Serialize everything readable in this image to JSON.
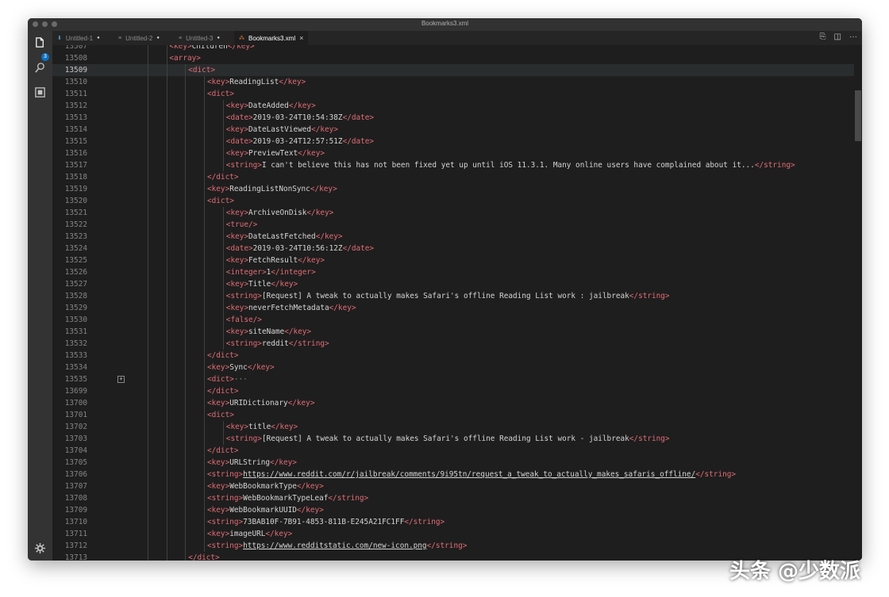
{
  "window": {
    "title": "Bookmarks3.xml"
  },
  "activity": {
    "badge": "3",
    "icons": [
      "files-icon",
      "search-icon",
      "extensions-icon",
      "gear-icon"
    ]
  },
  "tabs": [
    {
      "label": "Untitled-1",
      "icon": "pin-icon",
      "modified": "●"
    },
    {
      "label": "Untitled-2",
      "icon": "file-icon",
      "modified": "●"
    },
    {
      "label": "Untitled-3",
      "icon": "file-icon",
      "modified": "●"
    },
    {
      "label": "Bookmarks3.xml",
      "icon": "xml-icon",
      "close": "×",
      "active": true
    }
  ],
  "editor_actions": [
    "compare-icon",
    "split-icon",
    "more-icon"
  ],
  "editor": {
    "current_line": "13509",
    "lines": [
      {
        "n": "13507",
        "indent": 3,
        "parts": [
          {
            "t": "tag",
            "v": "<key>"
          },
          {
            "t": "txt",
            "v": "Children"
          },
          {
            "t": "tag",
            "v": "</key>"
          }
        ]
      },
      {
        "n": "13508",
        "indent": 3,
        "parts": [
          {
            "t": "tag",
            "v": "<array>"
          }
        ]
      },
      {
        "n": "13509",
        "indent": 4,
        "parts": [
          {
            "t": "tag",
            "v": "<dict>"
          }
        ]
      },
      {
        "n": "13510",
        "indent": 5,
        "parts": [
          {
            "t": "tag",
            "v": "<key>"
          },
          {
            "t": "txt",
            "v": "ReadingList"
          },
          {
            "t": "tag",
            "v": "</key>"
          }
        ]
      },
      {
        "n": "13511",
        "indent": 5,
        "parts": [
          {
            "t": "tag",
            "v": "<dict>"
          }
        ]
      },
      {
        "n": "13512",
        "indent": 6,
        "parts": [
          {
            "t": "tag",
            "v": "<key>"
          },
          {
            "t": "txt",
            "v": "DateAdded"
          },
          {
            "t": "tag",
            "v": "</key>"
          }
        ]
      },
      {
        "n": "13513",
        "indent": 6,
        "parts": [
          {
            "t": "tag",
            "v": "<date>"
          },
          {
            "t": "txt",
            "v": "2019-03-24T10:54:38Z"
          },
          {
            "t": "tag",
            "v": "</date>"
          }
        ]
      },
      {
        "n": "13514",
        "indent": 6,
        "parts": [
          {
            "t": "tag",
            "v": "<key>"
          },
          {
            "t": "txt",
            "v": "DateLastViewed"
          },
          {
            "t": "tag",
            "v": "</key>"
          }
        ]
      },
      {
        "n": "13515",
        "indent": 6,
        "parts": [
          {
            "t": "tag",
            "v": "<date>"
          },
          {
            "t": "txt",
            "v": "2019-03-24T12:57:51Z"
          },
          {
            "t": "tag",
            "v": "</date>"
          }
        ]
      },
      {
        "n": "13516",
        "indent": 6,
        "parts": [
          {
            "t": "tag",
            "v": "<key>"
          },
          {
            "t": "txt",
            "v": "PreviewText"
          },
          {
            "t": "tag",
            "v": "</key>"
          }
        ]
      },
      {
        "n": "13517",
        "indent": 6,
        "parts": [
          {
            "t": "tag",
            "v": "<string>"
          },
          {
            "t": "txt",
            "v": "I can't believe this has not been fixed yet up until iOS 11.3.1. Many online users have complained about it..."
          },
          {
            "t": "tag",
            "v": "</string>"
          }
        ]
      },
      {
        "n": "13518",
        "indent": 5,
        "parts": [
          {
            "t": "tag",
            "v": "</dict>"
          }
        ]
      },
      {
        "n": "13519",
        "indent": 5,
        "parts": [
          {
            "t": "tag",
            "v": "<key>"
          },
          {
            "t": "txt",
            "v": "ReadingListNonSync"
          },
          {
            "t": "tag",
            "v": "</key>"
          }
        ]
      },
      {
        "n": "13520",
        "indent": 5,
        "parts": [
          {
            "t": "tag",
            "v": "<dict>"
          }
        ]
      },
      {
        "n": "13521",
        "indent": 6,
        "parts": [
          {
            "t": "tag",
            "v": "<key>"
          },
          {
            "t": "txt",
            "v": "ArchiveOnDisk"
          },
          {
            "t": "tag",
            "v": "</key>"
          }
        ]
      },
      {
        "n": "13522",
        "indent": 6,
        "parts": [
          {
            "t": "tag",
            "v": "<true/>"
          }
        ]
      },
      {
        "n": "13523",
        "indent": 6,
        "parts": [
          {
            "t": "tag",
            "v": "<key>"
          },
          {
            "t": "txt",
            "v": "DateLastFetched"
          },
          {
            "t": "tag",
            "v": "</key>"
          }
        ]
      },
      {
        "n": "13524",
        "indent": 6,
        "parts": [
          {
            "t": "tag",
            "v": "<date>"
          },
          {
            "t": "txt",
            "v": "2019-03-24T10:56:12Z"
          },
          {
            "t": "tag",
            "v": "</date>"
          }
        ]
      },
      {
        "n": "13525",
        "indent": 6,
        "parts": [
          {
            "t": "tag",
            "v": "<key>"
          },
          {
            "t": "txt",
            "v": "FetchResult"
          },
          {
            "t": "tag",
            "v": "</key>"
          }
        ]
      },
      {
        "n": "13526",
        "indent": 6,
        "parts": [
          {
            "t": "tag",
            "v": "<integer>"
          },
          {
            "t": "txt",
            "v": "1"
          },
          {
            "t": "tag",
            "v": "</integer>"
          }
        ]
      },
      {
        "n": "13527",
        "indent": 6,
        "parts": [
          {
            "t": "tag",
            "v": "<key>"
          },
          {
            "t": "txt",
            "v": "Title"
          },
          {
            "t": "tag",
            "v": "</key>"
          }
        ]
      },
      {
        "n": "13528",
        "indent": 6,
        "parts": [
          {
            "t": "tag",
            "v": "<string>"
          },
          {
            "t": "txt",
            "v": "[Request] A tweak to actually makes Safari's offline Reading List work : jailbreak"
          },
          {
            "t": "tag",
            "v": "</string>"
          }
        ]
      },
      {
        "n": "13529",
        "indent": 6,
        "parts": [
          {
            "t": "tag",
            "v": "<key>"
          },
          {
            "t": "txt",
            "v": "neverFetchMetadata"
          },
          {
            "t": "tag",
            "v": "</key>"
          }
        ]
      },
      {
        "n": "13530",
        "indent": 6,
        "parts": [
          {
            "t": "tag",
            "v": "<false/>"
          }
        ]
      },
      {
        "n": "13531",
        "indent": 6,
        "parts": [
          {
            "t": "tag",
            "v": "<key>"
          },
          {
            "t": "txt",
            "v": "siteName"
          },
          {
            "t": "tag",
            "v": "</key>"
          }
        ]
      },
      {
        "n": "13532",
        "indent": 6,
        "parts": [
          {
            "t": "tag",
            "v": "<string>"
          },
          {
            "t": "txt",
            "v": "reddit"
          },
          {
            "t": "tag",
            "v": "</string>"
          }
        ]
      },
      {
        "n": "13533",
        "indent": 5,
        "parts": [
          {
            "t": "tag",
            "v": "</dict>"
          }
        ]
      },
      {
        "n": "13534",
        "indent": 5,
        "parts": [
          {
            "t": "tag",
            "v": "<key>"
          },
          {
            "t": "txt",
            "v": "Sync"
          },
          {
            "t": "tag",
            "v": "</key>"
          }
        ]
      },
      {
        "n": "13535",
        "indent": 5,
        "fold": "+",
        "parts": [
          {
            "t": "tag",
            "v": "<dict>"
          },
          {
            "t": "ellipsis",
            "v": "···"
          }
        ]
      },
      {
        "n": "13699",
        "indent": 5,
        "parts": [
          {
            "t": "tag",
            "v": "</dict>"
          }
        ]
      },
      {
        "n": "13700",
        "indent": 5,
        "parts": [
          {
            "t": "tag",
            "v": "<key>"
          },
          {
            "t": "txt",
            "v": "URIDictionary"
          },
          {
            "t": "tag",
            "v": "</key>"
          }
        ]
      },
      {
        "n": "13701",
        "indent": 5,
        "parts": [
          {
            "t": "tag",
            "v": "<dict>"
          }
        ]
      },
      {
        "n": "13702",
        "indent": 6,
        "parts": [
          {
            "t": "tag",
            "v": "<key>"
          },
          {
            "t": "txt",
            "v": "title"
          },
          {
            "t": "tag",
            "v": "</key>"
          }
        ]
      },
      {
        "n": "13703",
        "indent": 6,
        "parts": [
          {
            "t": "tag",
            "v": "<string>"
          },
          {
            "t": "txt",
            "v": "[Request] A tweak to actually makes Safari's offline Reading List work - jailbreak"
          },
          {
            "t": "tag",
            "v": "</string>"
          }
        ]
      },
      {
        "n": "13704",
        "indent": 5,
        "parts": [
          {
            "t": "tag",
            "v": "</dict>"
          }
        ]
      },
      {
        "n": "13705",
        "indent": 5,
        "parts": [
          {
            "t": "tag",
            "v": "<key>"
          },
          {
            "t": "txt",
            "v": "URLString"
          },
          {
            "t": "tag",
            "v": "</key>"
          }
        ]
      },
      {
        "n": "13706",
        "indent": 5,
        "parts": [
          {
            "t": "tag",
            "v": "<string>"
          },
          {
            "t": "url",
            "v": "https://www.reddit.com/r/jailbreak/comments/9i95tn/request_a_tweak_to_actually_makes_safaris_offline/"
          },
          {
            "t": "tag",
            "v": "</string>"
          }
        ]
      },
      {
        "n": "13707",
        "indent": 5,
        "parts": [
          {
            "t": "tag",
            "v": "<key>"
          },
          {
            "t": "txt",
            "v": "WebBookmarkType"
          },
          {
            "t": "tag",
            "v": "</key>"
          }
        ]
      },
      {
        "n": "13708",
        "indent": 5,
        "parts": [
          {
            "t": "tag",
            "v": "<string>"
          },
          {
            "t": "txt",
            "v": "WebBookmarkTypeLeaf"
          },
          {
            "t": "tag",
            "v": "</string>"
          }
        ]
      },
      {
        "n": "13709",
        "indent": 5,
        "parts": [
          {
            "t": "tag",
            "v": "<key>"
          },
          {
            "t": "txt",
            "v": "WebBookmarkUUID"
          },
          {
            "t": "tag",
            "v": "</key>"
          }
        ]
      },
      {
        "n": "13710",
        "indent": 5,
        "parts": [
          {
            "t": "tag",
            "v": "<string>"
          },
          {
            "t": "txt",
            "v": "73BAB10F-7B91-4853-811B-E245A21FC1FF"
          },
          {
            "t": "tag",
            "v": "</string>"
          }
        ]
      },
      {
        "n": "13711",
        "indent": 5,
        "parts": [
          {
            "t": "tag",
            "v": "<key>"
          },
          {
            "t": "txt",
            "v": "imageURL"
          },
          {
            "t": "tag",
            "v": "</key>"
          }
        ]
      },
      {
        "n": "13712",
        "indent": 5,
        "parts": [
          {
            "t": "tag",
            "v": "<string>"
          },
          {
            "t": "url",
            "v": "https://www.redditstatic.com/new-icon.png"
          },
          {
            "t": "tag",
            "v": "</string>"
          }
        ]
      },
      {
        "n": "13713",
        "indent": 4,
        "parts": [
          {
            "t": "tag",
            "v": "</dict>"
          }
        ]
      }
    ]
  },
  "watermark": "头条 @少数派",
  "colors": {
    "tag": "#e06c75",
    "text": "#d4d4d4",
    "background": "#1e1e1e"
  }
}
